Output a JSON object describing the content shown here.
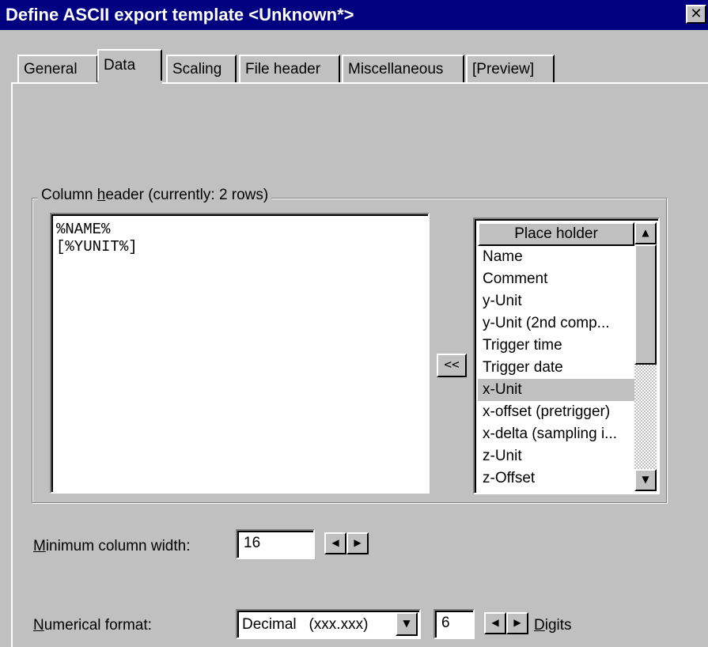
{
  "window": {
    "title": "Define ASCII export template <Unknown*>",
    "close_glyph": "✕"
  },
  "tabs": [
    {
      "label": "General"
    },
    {
      "label": "Data",
      "active": true
    },
    {
      "label": "Scaling"
    },
    {
      "label": "File header"
    },
    {
      "label": "Miscellaneous"
    },
    {
      "label": "[Preview]"
    }
  ],
  "column_header": {
    "group_label_pre": "Column ",
    "group_label_accel": "h",
    "group_label_post": "eader (currently: 2 rows)",
    "lines": [
      "%NAME%",
      "[%YUNIT%]"
    ],
    "insert_button": "<<"
  },
  "placeholder_list": {
    "header": "Place holder",
    "items": [
      "Name",
      "Comment",
      "y-Unit",
      "y-Unit (2nd comp...",
      "Trigger time",
      "Trigger date",
      "x-Unit",
      "x-offset (pretrigger)",
      "x-delta (sampling i...",
      "z-Unit",
      "z-Offset"
    ],
    "selected": "x-Unit",
    "scroll_up": "▲",
    "scroll_down": "▼"
  },
  "min_width": {
    "label_accel": "M",
    "label_rest": "inimum column width:",
    "value": "16",
    "dec": "◀",
    "inc": "▶"
  },
  "numerical": {
    "label_accel": "N",
    "label_rest": "umerical format:",
    "format_value": "Decimal   (xxx.xxx)",
    "dropdown_glyph": "▼",
    "digits_value": "6",
    "dec": "◀",
    "inc": "▶",
    "digits_accel": "D",
    "digits_rest": "igits"
  }
}
